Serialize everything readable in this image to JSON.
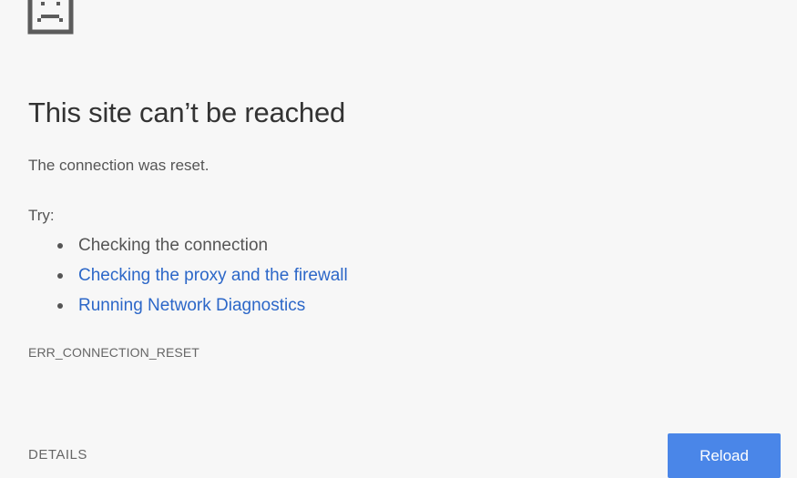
{
  "icon": {
    "name": "sad-page-icon"
  },
  "error": {
    "title": "This site can’t be reached",
    "message": "The connection was reset.",
    "try_label": "Try:",
    "suggestions": [
      {
        "text": "Checking the connection",
        "is_link": false
      },
      {
        "text": "Checking the proxy and the firewall",
        "is_link": true
      },
      {
        "text": "Running Network Diagnostics",
        "is_link": true
      }
    ],
    "code": "ERR_CONNECTION_RESET"
  },
  "buttons": {
    "details_label": "DETAILS",
    "reload_label": "Reload"
  },
  "colors": {
    "background": "#f7f7f7",
    "link": "#2c67c8",
    "primary_button": "#4a86e8"
  }
}
